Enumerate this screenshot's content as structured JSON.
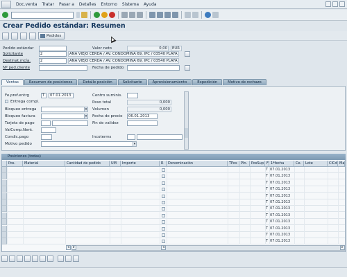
{
  "menu": [
    "Doc.venta",
    "Tratar",
    "Pasar a",
    "Detalles",
    "Entorno",
    "Sistema",
    "Ayuda"
  ],
  "page_title": "Crear Pedido estándar: Resumen",
  "app_toolbar": {
    "pedidos_label": "Pedidos"
  },
  "header": {
    "pedido_estandar_label": "Pedido estándar",
    "valor_neto_label": "Valor neto",
    "valor_neto_value": "0,00",
    "currency": "EUR",
    "solicitante_label": "Solicitante",
    "solicitante_value": "2",
    "solicitante_desc": "ANA VIEJO CERDA / AV. CONDOMINA 69, IPC / 03540 PLAYA S",
    "destinat_label": "Destinat.mcía.",
    "destinat_value": "2",
    "destinat_desc": "ANA VIEJO CERDA / AV. CONDOMINA 69, IPC / 03540 PLAYA S",
    "ped_cliente_label": "Nº ped.cliente",
    "fecha_pedido_label": "Fecha de pedido"
  },
  "tabs": [
    "Ventas",
    "Resumen de posiciones",
    "Detalle posición",
    "Solicitante",
    "Aprovisionamiento",
    "Expedición",
    "Motivo de rechazo"
  ],
  "ventas": {
    "fe_pref_entrg_label": "Fe.pref.entrg",
    "fe_pref_unit": "T",
    "fe_pref_value": "07.01.2013",
    "centro_suminis_label": "Centro suminis.",
    "entrega_compl_label": "Entrega compl.",
    "peso_total_label": "Peso total",
    "peso_total_value": "0,000",
    "bloqueo_entrega_label": "Bloqueo entrega",
    "volumen_label": "Volumen",
    "volumen_value": "0,000",
    "bloqueo_factura_label": "Bloqueo factura",
    "fecha_precio_label": "Fecha de precio",
    "fecha_precio_value": "06.01.2013",
    "tarjeta_pago_label": "Tarjeta de pago",
    "fin_validez_label": "Fin de validez",
    "valcomp_label": "ValComp.Nent.",
    "condic_pago_label": "Condic.pago",
    "incoterms_label": "Incoterms",
    "motivo_pedido_label": "Motivo pedido"
  },
  "grid": {
    "title": "Posiciones (todas)",
    "columns": [
      "Pos.",
      "Material",
      "Cantidad de pedido",
      "UM",
      "Importe",
      "R",
      "Denominación",
      "TPos",
      "Pln.",
      "PosSup",
      "F",
      "1ªfecha",
      "Ce.",
      "Lote",
      "ClCd",
      "Mar"
    ],
    "rows": [
      {
        "f": "T",
        "date": "07.01.2013"
      },
      {
        "f": "T",
        "date": "07.01.2013"
      },
      {
        "f": "T",
        "date": "07.01.2013"
      },
      {
        "f": "T",
        "date": "07.01.2013"
      },
      {
        "f": "T",
        "date": "07.01.2013"
      },
      {
        "f": "T",
        "date": "07.01.2013"
      },
      {
        "f": "T",
        "date": "07.01.2013"
      },
      {
        "f": "T",
        "date": "07.01.2013"
      },
      {
        "f": "T",
        "date": "07.01.2013"
      },
      {
        "f": "T",
        "date": "07.01.2013"
      },
      {
        "f": "T",
        "date": "07.01.2013"
      },
      {
        "f": "T",
        "date": "07.01.2013"
      }
    ]
  }
}
